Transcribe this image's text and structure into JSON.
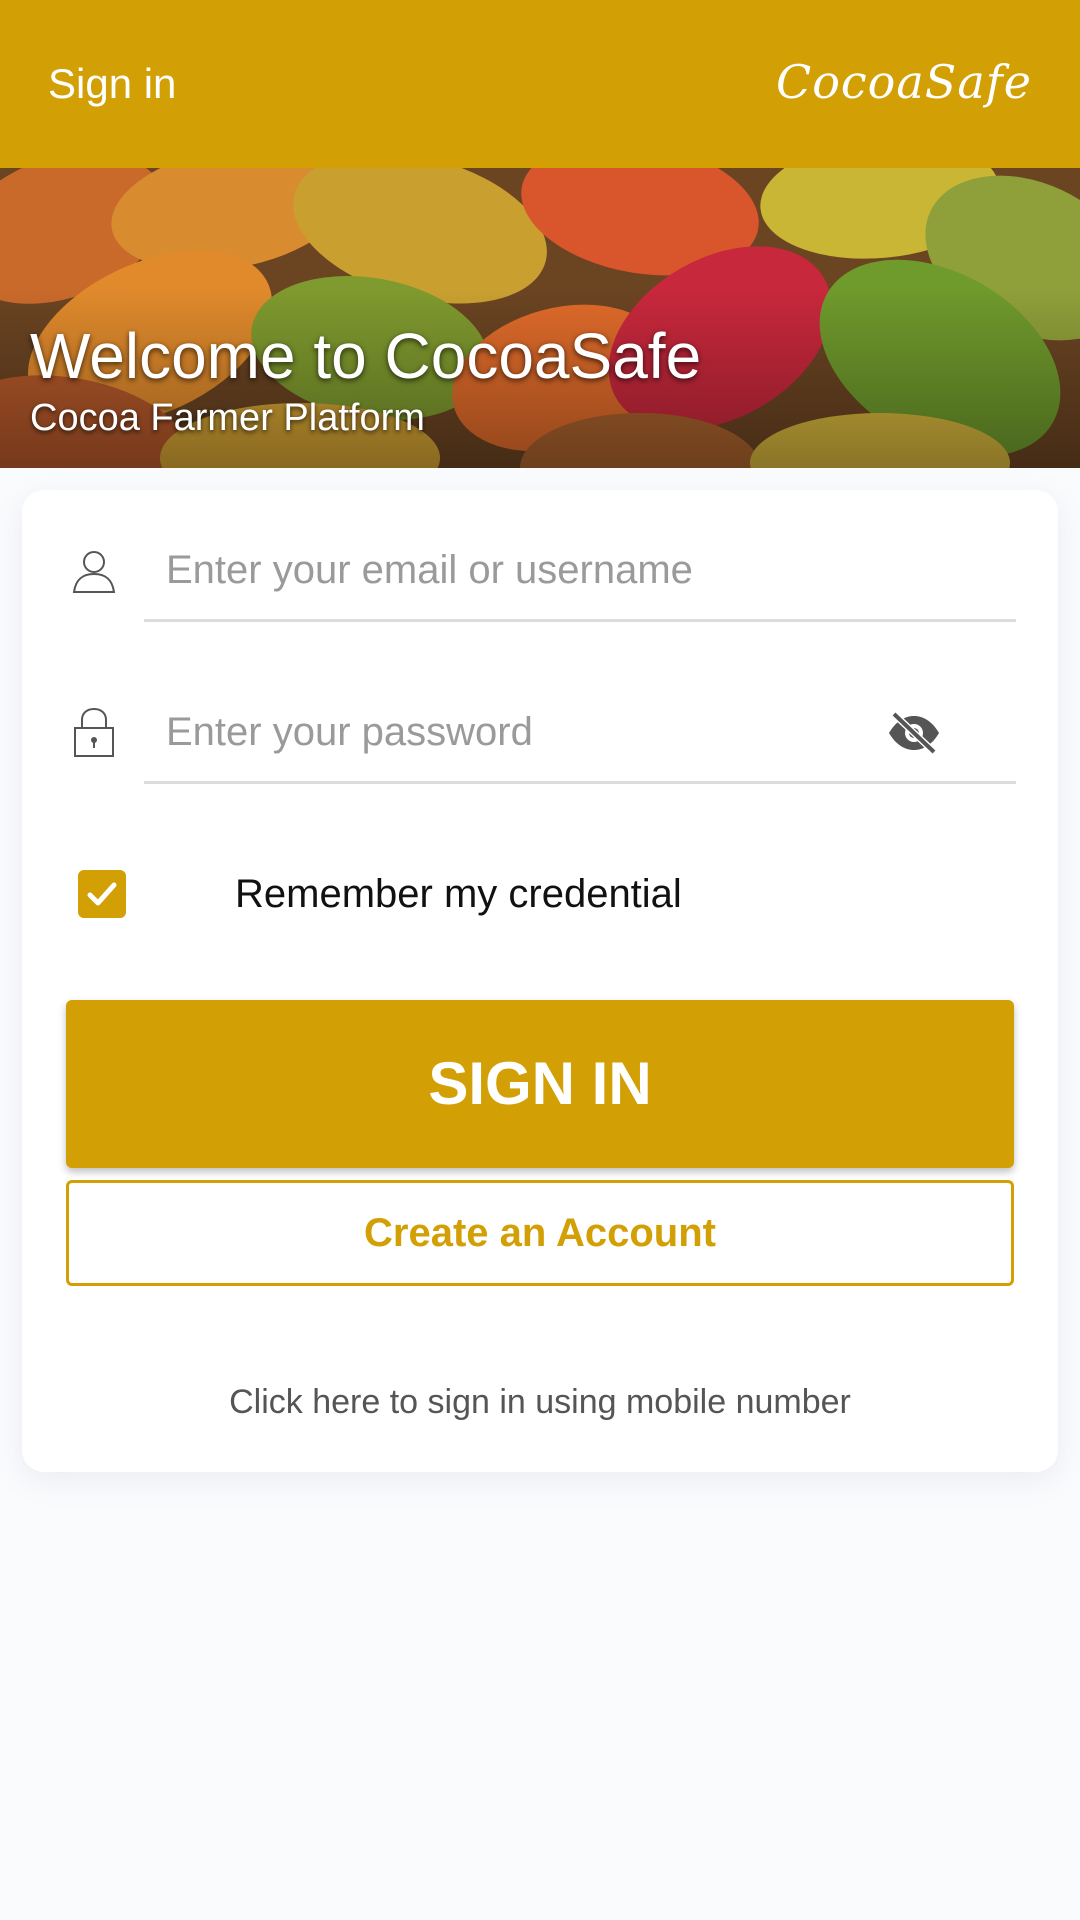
{
  "appbar": {
    "title": "Sign in",
    "brand": "CocoaSafe"
  },
  "hero": {
    "welcome": "Welcome to CocoaSafe",
    "subtitle": "Cocoa Farmer Platform",
    "image": "cocoa-pods-photo"
  },
  "form": {
    "username": {
      "placeholder": "Enter your email or username",
      "value": "",
      "icon": "user-icon"
    },
    "password": {
      "placeholder": "Enter your password",
      "value": "",
      "icon": "lock-icon",
      "visibility_icon": "eye-off-icon"
    },
    "remember": {
      "label": "Remember my credential",
      "checked": true
    },
    "sign_in_label": "SIGN IN",
    "create_account_label": "Create an Account",
    "mobile_link": "Click here to sign in using mobile number"
  },
  "colors": {
    "primary": "#d29f05",
    "background": "#fafbfd",
    "card": "#ffffff",
    "placeholder": "#9a9a9a",
    "divider": "#dcdcdc"
  }
}
